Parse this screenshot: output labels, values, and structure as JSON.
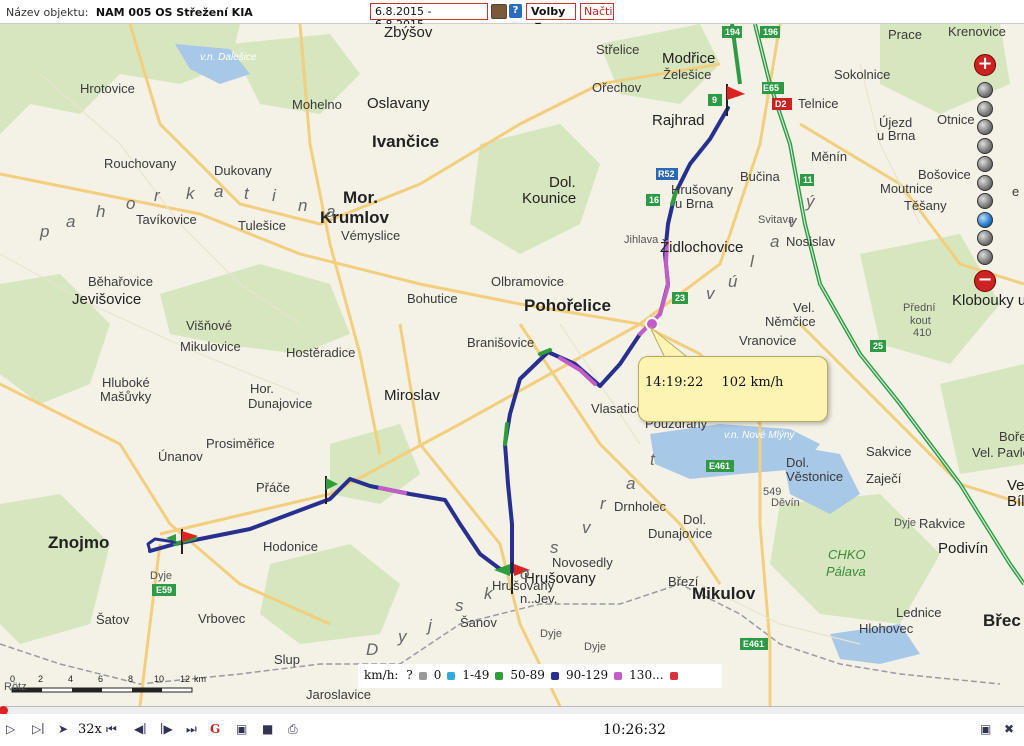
{
  "header": {
    "object_label": "Název objektu:",
    "object_value": "NAM 005 OS Střežení KIA",
    "date_range": "6.8.2015 - 6.8.2015",
    "help_label": "?",
    "options_label": "Volby",
    "load_label": "Načti"
  },
  "map": {
    "places": [
      {
        "t": "Zbýšov",
        "c": "med"
      },
      {
        "t": "Střelice",
        "c": ""
      },
      {
        "t": "Modřice",
        "c": "med"
      },
      {
        "t": "Želešice",
        "c": ""
      },
      {
        "t": "Prace",
        "c": ""
      },
      {
        "t": "Sokolnice",
        "c": ""
      },
      {
        "t": "Hrotovice",
        "c": ""
      },
      {
        "t": "Mohelno",
        "c": ""
      },
      {
        "t": "Oslavany",
        "c": "med"
      },
      {
        "t": "Ořechov",
        "c": ""
      },
      {
        "t": "Rajhrad",
        "c": "med"
      },
      {
        "t": "Telnice",
        "c": ""
      },
      {
        "t": "Újezd",
        "c": ""
      },
      {
        "t": "u Brna",
        "c": ""
      },
      {
        "t": "Otnice",
        "c": ""
      },
      {
        "t": "Ivančice",
        "c": "big"
      },
      {
        "t": "Rouchovany",
        "c": ""
      },
      {
        "t": "Dukovany",
        "c": ""
      },
      {
        "t": "Měnín",
        "c": ""
      },
      {
        "t": "Bučina",
        "c": ""
      },
      {
        "t": "Bošovice",
        "c": ""
      },
      {
        "t": "Hrušovany",
        "c": ""
      },
      {
        "t": "u Brna",
        "c": ""
      },
      {
        "t": "Moutnice",
        "c": ""
      },
      {
        "t": "Dol.",
        "c": "med"
      },
      {
        "t": "Kounice",
        "c": "med"
      },
      {
        "t": "Mor.",
        "c": "big"
      },
      {
        "t": "Krumlov",
        "c": "big"
      },
      {
        "t": "Vémyslice",
        "c": ""
      },
      {
        "t": "Tavíkovice",
        "c": ""
      },
      {
        "t": "Tulešice",
        "c": ""
      },
      {
        "t": "Těšany",
        "c": ""
      },
      {
        "t": "Židlochovice",
        "c": "med"
      },
      {
        "t": "Nosislav",
        "c": ""
      },
      {
        "t": "Běhařovice",
        "c": ""
      },
      {
        "t": "Jevišovice",
        "c": "med"
      },
      {
        "t": "Olbramovice",
        "c": ""
      },
      {
        "t": "Bohutice",
        "c": ""
      },
      {
        "t": "Pohořelice",
        "c": "big"
      },
      {
        "t": "Klobouky u",
        "c": "med"
      },
      {
        "t": "Višňové",
        "c": ""
      },
      {
        "t": "Vel.",
        "c": ""
      },
      {
        "t": "Němčice",
        "c": ""
      },
      {
        "t": "Mikulovice",
        "c": ""
      },
      {
        "t": "Hostěradice",
        "c": ""
      },
      {
        "t": "Branišovice",
        "c": ""
      },
      {
        "t": "Vranovice",
        "c": ""
      },
      {
        "t": "Hluboké",
        "c": ""
      },
      {
        "t": "Mašůvky",
        "c": ""
      },
      {
        "t": "Hor.",
        "c": ""
      },
      {
        "t": "Dunajovice",
        "c": ""
      },
      {
        "t": "Miroslav",
        "c": "med"
      },
      {
        "t": "Vlasatice",
        "c": ""
      },
      {
        "t": "Pouzdřany",
        "c": ""
      },
      {
        "t": "Prosiměřice",
        "c": ""
      },
      {
        "t": "Sakvice",
        "c": ""
      },
      {
        "t": "Bořetice",
        "c": ""
      },
      {
        "t": "Vel. Pavlovice",
        "c": ""
      },
      {
        "t": "Únanov",
        "c": ""
      },
      {
        "t": "Dol.",
        "c": ""
      },
      {
        "t": "Věstonice",
        "c": ""
      },
      {
        "t": "Zaječí",
        "c": ""
      },
      {
        "t": "Přáče",
        "c": ""
      },
      {
        "t": "Znojmo",
        "c": "big"
      },
      {
        "t": "Hodonice",
        "c": ""
      },
      {
        "t": "Drnholec",
        "c": ""
      },
      {
        "t": "Dol.",
        "c": ""
      },
      {
        "t": "Dunajovice",
        "c": ""
      },
      {
        "t": "Rakvice",
        "c": ""
      },
      {
        "t": "Novosedly",
        "c": ""
      },
      {
        "t": "Hrušovany",
        "c": "med"
      },
      {
        "t": "n..Jev.",
        "c": ""
      },
      {
        "t": "Březí",
        "c": ""
      },
      {
        "t": "Podivín",
        "c": "med"
      },
      {
        "t": "CHKO",
        "c": "green"
      },
      {
        "t": "Pálava",
        "c": "green"
      },
      {
        "t": "Šatov",
        "c": ""
      },
      {
        "t": "Vrbovec",
        "c": ""
      },
      {
        "t": "Šanov",
        "c": ""
      },
      {
        "t": "Mikulov",
        "c": "big"
      },
      {
        "t": "Lednice",
        "c": ""
      },
      {
        "t": "Hlohovec",
        "c": ""
      },
      {
        "t": "Břec",
        "c": "big"
      },
      {
        "t": "Slup",
        "c": ""
      },
      {
        "t": "Jaroslavice",
        "c": ""
      },
      {
        "t": "Hrušovany",
        "c": ""
      },
      {
        "t": "Přední",
        "c": "sm"
      },
      {
        "t": "kout",
        "c": "sm"
      },
      {
        "t": "410",
        "c": "sm"
      },
      {
        "t": "549",
        "c": "sm"
      },
      {
        "t": "Děvín",
        "c": "sm"
      },
      {
        "t": "Vel",
        "c": "med"
      },
      {
        "t": "Bíl",
        "c": "med"
      },
      {
        "t": "Krenovice",
        "c": ""
      },
      {
        "t": "v.n. Dalešice",
        "c": "lake"
      },
      {
        "t": "v.n. Nové Mlýny",
        "c": "lake"
      },
      {
        "t": "Jihlava",
        "c": "sm"
      },
      {
        "t": "Dyje",
        "c": "sm"
      },
      {
        "t": "Dyje",
        "c": "sm"
      },
      {
        "t": "Dyje",
        "c": "sm"
      },
      {
        "t": "Dyje",
        "c": "sm"
      },
      {
        "t": "Svitava",
        "c": "sm"
      },
      {
        "t": "Rötz",
        "c": "sm"
      },
      {
        "t": "e",
        "c": ""
      }
    ],
    "region_letters": [
      {
        "t": "p"
      },
      {
        "t": "a"
      },
      {
        "t": "h"
      },
      {
        "t": "o"
      },
      {
        "t": "r"
      },
      {
        "t": "k"
      },
      {
        "t": "a"
      },
      {
        "t": "t"
      },
      {
        "t": "i"
      },
      {
        "t": "n"
      },
      {
        "t": "a"
      },
      {
        "t": "D"
      },
      {
        "t": "y"
      },
      {
        "t": "j"
      },
      {
        "t": "s"
      },
      {
        "t": "k"
      },
      {
        "t": "o"
      },
      {
        "t": "s"
      },
      {
        "t": "v"
      },
      {
        "t": "r"
      },
      {
        "t": "a"
      },
      {
        "t": "t"
      },
      {
        "t": "ý"
      },
      {
        "t": "v"
      },
      {
        "t": "a"
      },
      {
        "t": "l"
      },
      {
        "t": "ú"
      },
      {
        "t": "v"
      }
    ],
    "road_numbers": [
      "194",
      "196",
      "9",
      "E65",
      "D2",
      "R52",
      "16",
      "11",
      "23",
      "25",
      "E461",
      "E59",
      "E461"
    ]
  },
  "tooltip": {
    "time": "14:19:22",
    "speed": "102 km/h"
  },
  "legend": {
    "title": "km/h:",
    "items": [
      {
        "label": "?",
        "color": "#999999"
      },
      {
        "label": "0",
        "color": "#33aadd"
      },
      {
        "label": "1-49",
        "color": "#2f9e3a"
      },
      {
        "label": "50-89",
        "color": "#27308f"
      },
      {
        "label": "90-129",
        "color": "#c35cc9"
      },
      {
        "label": "130...",
        "color": "#d8333b"
      }
    ]
  },
  "scale": {
    "ticks": [
      "2",
      "4",
      "6",
      "8",
      "10",
      "12"
    ],
    "zero": "0",
    "unit": "km"
  },
  "zoom": {
    "plus": "+",
    "minus": "−",
    "levels": 10,
    "active_level": 7
  },
  "player": {
    "speed": "32x",
    "time": "10:26:32",
    "progress": 0
  },
  "colors": {
    "route": "#27308f",
    "route_fast": "#c35cc9",
    "route_slow": "#2f9e3a",
    "highway": "#3aa64a",
    "road": "#f6d07a",
    "water": "#9fc2e6",
    "forest": "#cfe3b4"
  }
}
